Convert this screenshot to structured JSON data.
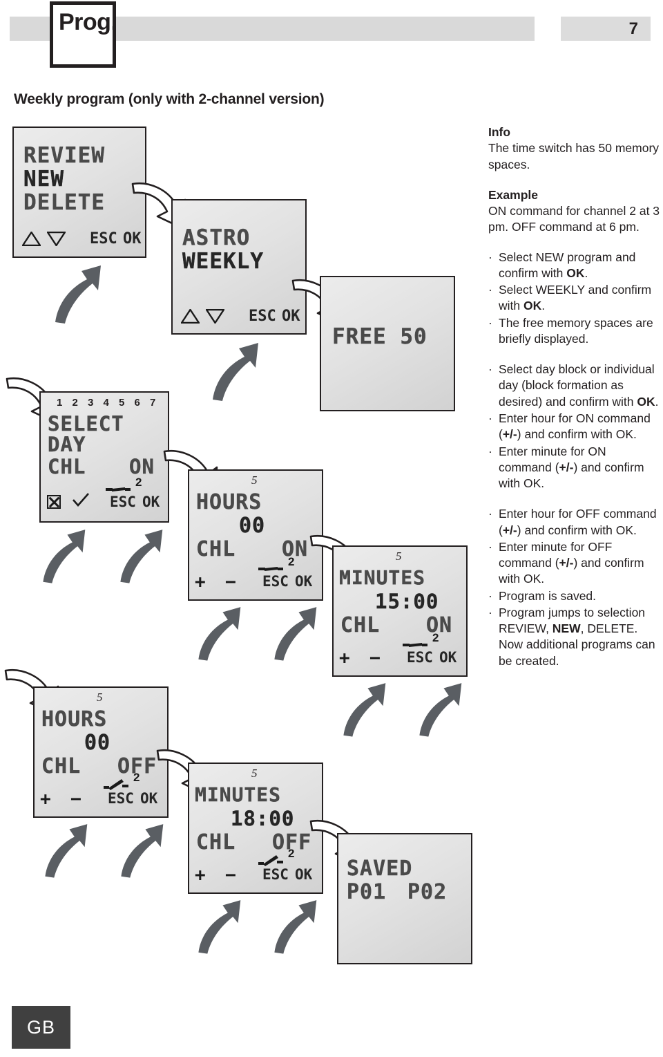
{
  "header": {
    "prog_label": "Prog.",
    "page_number": "7"
  },
  "section_title": "Weekly program (only with 2-channel version)",
  "footer": {
    "language_badge": "GB"
  },
  "panels": {
    "menu": {
      "line1": "REVIEW",
      "line2": "NEW",
      "line3": "DELETE",
      "esc": "ESC",
      "ok": "OK"
    },
    "mode": {
      "line1": "ASTRO",
      "line2": "WEEKLY",
      "esc": "ESC",
      "ok": "OK"
    },
    "free": {
      "line1": "FREE 50"
    },
    "select_day": {
      "daynums": "1 2 3 4 5 6 7",
      "line1": "SELECT",
      "line2": "DAY",
      "chl": "CHL",
      "state": "ON",
      "channel": "2",
      "esc": "ESC",
      "ok": "OK"
    },
    "hours_on": {
      "memory": "5",
      "label": "HOURS",
      "value": "00",
      "chl": "CHL",
      "state": "ON",
      "channel": "2",
      "plus": "+",
      "minus": "−",
      "esc": "ESC",
      "ok": "OK"
    },
    "minutes_on": {
      "memory": "5",
      "label": "MINUTES",
      "value": "15:00",
      "chl": "CHL",
      "state": "ON",
      "channel": "2",
      "plus": "+",
      "minus": "−",
      "esc": "ESC",
      "ok": "OK"
    },
    "hours_off": {
      "memory": "5",
      "label": "HOURS",
      "value": "00",
      "chl": "CHL",
      "state": "OFF",
      "channel": "2",
      "plus": "+",
      "minus": "−",
      "esc": "ESC",
      "ok": "OK"
    },
    "minutes_off": {
      "memory": "5",
      "label": "MINUTES",
      "value": "18:00",
      "chl": "CHL",
      "state": "OFF",
      "channel": "2",
      "plus": "+",
      "minus": "−",
      "esc": "ESC",
      "ok": "OK"
    },
    "saved": {
      "line1": "SAVED",
      "line2a": "P01",
      "line2b": "P02"
    }
  },
  "info": {
    "heading": "Info",
    "body": "The time switch has 50 memory spaces."
  },
  "example": {
    "heading": "Example",
    "body": "ON command for channel 2 at 3 pm. OFF command at 6 pm."
  },
  "steps": [
    {
      "bullet": "·",
      "text": "Select NEW program and confirm with ",
      "bold": "OK",
      "tail": "."
    },
    {
      "bullet": "·",
      "text": "Select WEEKLY and confirm with ",
      "bold": "OK",
      "tail": "."
    },
    {
      "bullet": "·",
      "text": "The free memory spaces are briefly displayed.",
      "bold": "",
      "tail": ""
    }
  ],
  "steps2": [
    {
      "bullet": "·",
      "text": "Select day block or individual day (block formation as desired) and confirm with ",
      "bold": "OK",
      "tail": "."
    },
    {
      "bullet": "·",
      "text": "Enter hour for ON command (",
      "bold": "+/-",
      "tail": ") and confirm with OK."
    },
    {
      "bullet": "·",
      "text": "Enter minute for ON command (",
      "bold": "+/-",
      "tail": ") and confirm with OK."
    }
  ],
  "steps3": [
    {
      "bullet": "·",
      "text": "Enter hour for OFF command (",
      "bold": "+/-",
      "tail": ") and confirm with OK."
    },
    {
      "bullet": "·",
      "text": "Enter minute for OFF command (",
      "bold": "+/-",
      "tail": ") and confirm with OK."
    },
    {
      "bullet": "·",
      "text": "Program is saved.",
      "bold": "",
      "tail": ""
    },
    {
      "bullet": "·",
      "text": "Program jumps to selection REVIEW, ",
      "bold": "NEW",
      "tail": ", DELETE. Now additional programs can be created."
    }
  ],
  "colors": {
    "ink": "#231f20",
    "lcd_bg": "#e6e6e6",
    "arrow_gray": "#5a5e63",
    "badge_bg": "#404040"
  }
}
